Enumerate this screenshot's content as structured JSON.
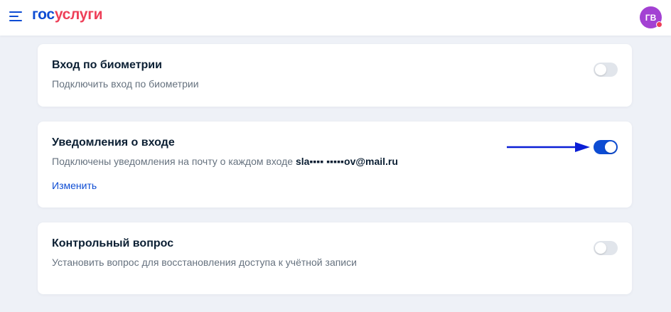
{
  "header": {
    "logo_part1": "гос",
    "logo_part2": "услуги",
    "avatar_initials": "ГВ"
  },
  "cards": [
    {
      "title": "Вход по биометрии",
      "description": "Подключить вход по биометрии",
      "toggle_state": "off"
    },
    {
      "title": "Уведомления о входе",
      "description": "Подключены уведомления на почту о каждом входе",
      "email": "sla▪▪▪▪ ▪▪▪▪▪ov@mail.ru",
      "link": "Изменить",
      "toggle_state": "on"
    },
    {
      "title": "Контрольный вопрос",
      "description": "Установить вопрос для восстановления доступа к учётной записи",
      "toggle_state": "off"
    }
  ],
  "colors": {
    "brand_blue": "#0d4cd3",
    "brand_red": "#ee3f58",
    "avatar": "#a341d3",
    "background": "#eef1f7"
  },
  "icons": {
    "menu": "hamburger-menu-icon",
    "annotation": "blue-arrow"
  }
}
